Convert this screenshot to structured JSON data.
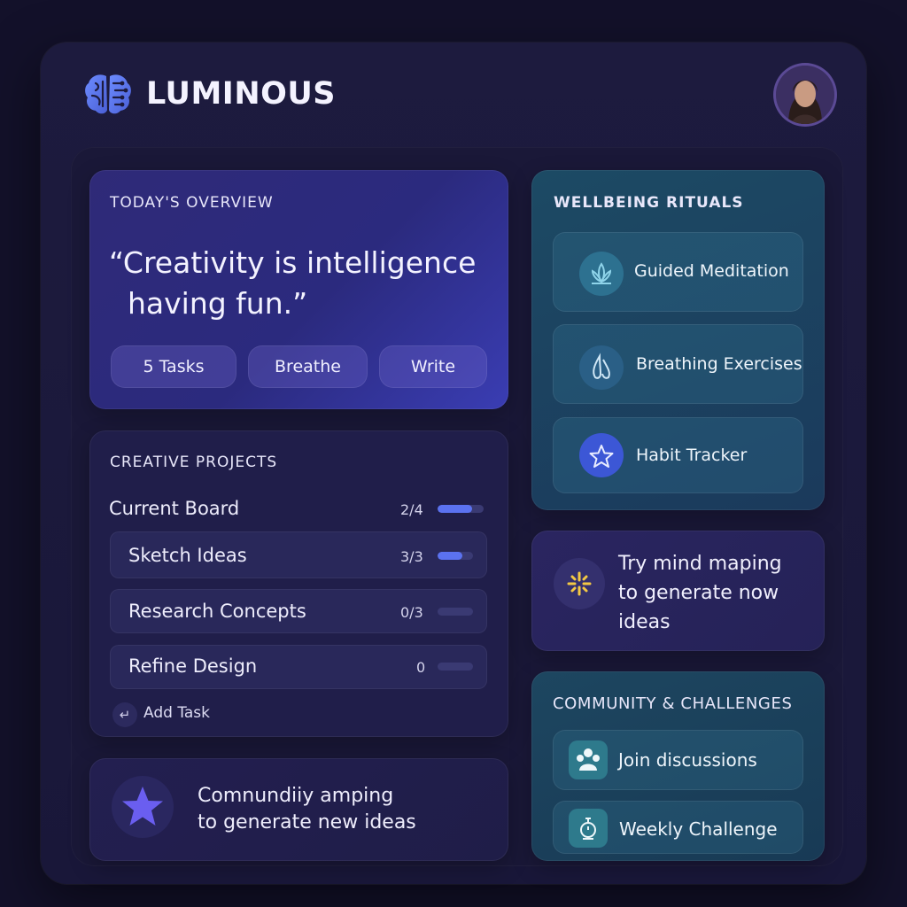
{
  "app": {
    "brand": "LUMINOUS",
    "logo_icon": "brain-icon",
    "avatar_icon": "user-avatar"
  },
  "overview": {
    "title": "TODAY'S OVERVIEW",
    "quote_line1": "“Creativity is intelligence",
    "quote_line2": "having fun.”",
    "pills": [
      {
        "label": "5  Tasks"
      },
      {
        "label": "Breathe"
      },
      {
        "label": "Write"
      }
    ]
  },
  "projects": {
    "title": "CREATIVE PROJECTS",
    "board": {
      "label": "Current Board",
      "count": "2/4",
      "progress": 0.75
    },
    "tasks": [
      {
        "label": "Sketch Ideas",
        "count": "3/3",
        "progress": 0.7
      },
      {
        "label": "Research Concepts",
        "count": "0/3",
        "progress": 0
      },
      {
        "label": "Refine Design",
        "count": "0",
        "progress": 0
      }
    ],
    "add_task": {
      "icon": "plus-icon",
      "label": "Add Task"
    }
  },
  "community_promo": {
    "icon": "star-icon",
    "line1": "Comnundiiy amping",
    "line2": "to generate new ideas"
  },
  "wellbeing": {
    "title": "WELLBEING RITUALS",
    "items": [
      {
        "icon": "lotus-icon",
        "label": "Guided Meditation"
      },
      {
        "icon": "breath-icon",
        "label": "Breathing Exercises"
      },
      {
        "icon": "star-icon",
        "label": "Habit Tracker"
      }
    ]
  },
  "mind_map": {
    "icon": "sparkle-icon",
    "line1": "Try mind maping",
    "line2": "to generate now",
    "line3": "ideas"
  },
  "challenges": {
    "title": "COMMUNITY & CHALLENGES",
    "items": [
      {
        "icon": "group-icon",
        "label": "Join discussions"
      },
      {
        "icon": "stopwatch-icon",
        "label": "Weekly Challenge"
      }
    ]
  },
  "colors": {
    "accent": "#5b72f0",
    "background": "#13112a",
    "teal_card": "#1c4a64"
  }
}
